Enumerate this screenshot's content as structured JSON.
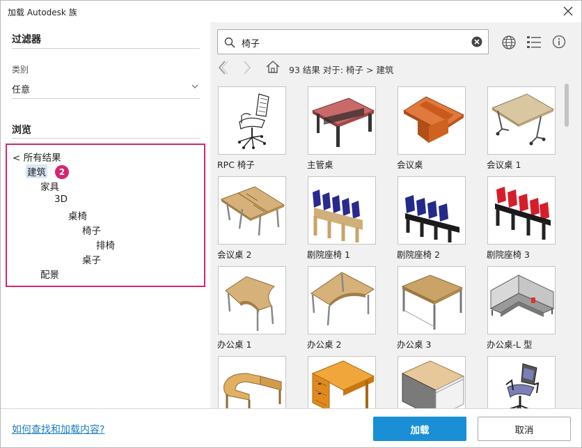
{
  "window": {
    "title": "加载 Autodesk 族"
  },
  "filter": {
    "heading": "过滤器",
    "category_label": "类别",
    "category_value": "任意"
  },
  "browse": {
    "heading": "浏览",
    "tree": [
      {
        "label": "< 所有结果",
        "level": 0
      },
      {
        "label": "建筑",
        "level": 1,
        "selected": true
      },
      {
        "label": "家具",
        "level": 2
      },
      {
        "label": "3D",
        "level": 3
      },
      {
        "label": "桌椅",
        "level": 4
      },
      {
        "label": "椅子",
        "level": 5
      },
      {
        "label": "排椅",
        "level": 6
      },
      {
        "label": "桌子",
        "level": 5
      },
      {
        "label": "配景",
        "level": 2
      }
    ],
    "badge": "2"
  },
  "search": {
    "value": "椅子"
  },
  "breadcrumb": "93 结果 对于: 椅子 > 建筑",
  "results": [
    {
      "label": "RPC 椅子",
      "icon": "rpc-chair"
    },
    {
      "label": "主管桌",
      "icon": "executive-desk"
    },
    {
      "label": "会议桌",
      "icon": "conference-table-boat"
    },
    {
      "label": "会议桌 1",
      "icon": "conference-table-folding"
    },
    {
      "label": "会议桌 2",
      "icon": "conference-table-wood"
    },
    {
      "label": "剧院座椅 1",
      "icon": "theater-seats-blue-wood"
    },
    {
      "label": "剧院座椅 2",
      "icon": "theater-seats-blue"
    },
    {
      "label": "剧院座椅 3",
      "icon": "theater-seats-red"
    },
    {
      "label": "办公桌 1",
      "icon": "office-desk-curved"
    },
    {
      "label": "办公桌 2",
      "icon": "office-desk-corner"
    },
    {
      "label": "办公桌 3",
      "icon": "office-desk-rect"
    },
    {
      "label": "办公桌-L 型",
      "icon": "office-desk-l-shape"
    },
    {
      "label": "",
      "icon": "desk-u-shape"
    },
    {
      "label": "",
      "icon": "desk-drawers"
    },
    {
      "label": "",
      "icon": "desk-cabinet"
    },
    {
      "label": "",
      "icon": "office-chair"
    }
  ],
  "footer": {
    "help_link": "如何查找和加载内容?",
    "load_button": "加载",
    "cancel_button": "取消"
  },
  "colors": {
    "accent": "#1a8fd6",
    "highlight": "#d6246e",
    "selection": "#dbe8f5"
  }
}
